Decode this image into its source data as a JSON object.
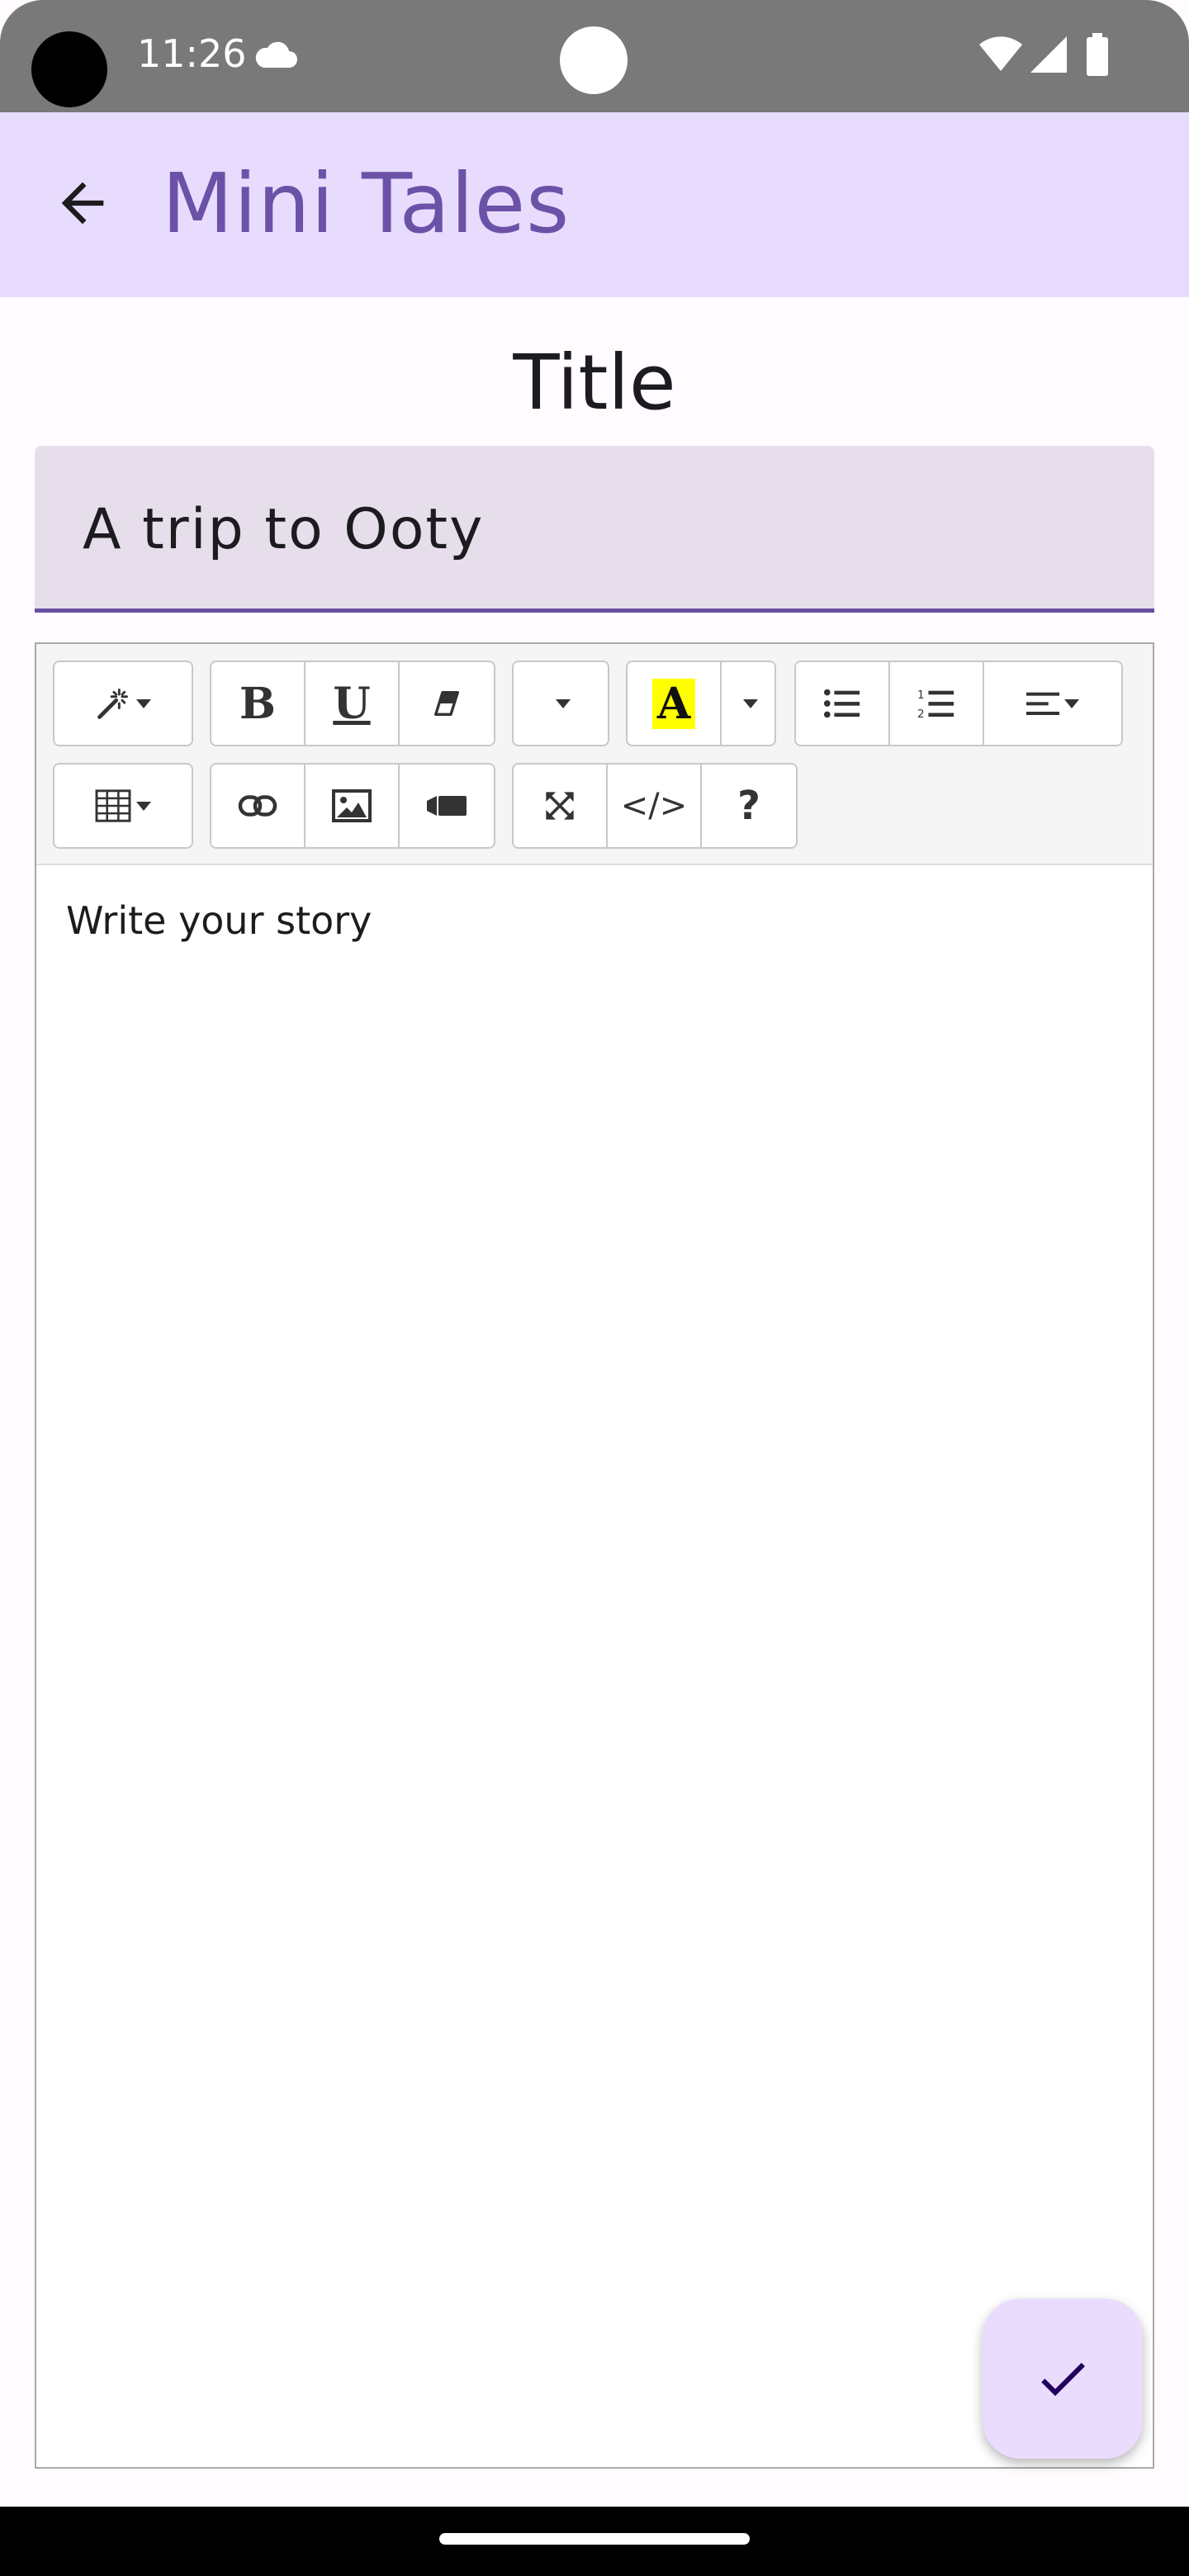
{
  "status_bar": {
    "time": "11:26",
    "icons": [
      "cloud-icon",
      "wifi-icon",
      "signal-icon",
      "battery-icon"
    ]
  },
  "app_bar": {
    "title": "Mini Tales",
    "back_icon": "arrow-left-icon"
  },
  "form": {
    "title_label": "Title",
    "title_value": "A trip to Ooty"
  },
  "editor": {
    "placeholder": "Write your story",
    "toolbar": {
      "row1": [
        "magic-wand-icon",
        "bold-icon",
        "underline-icon",
        "eraser-icon",
        "font-dropdown",
        "text-color-icon",
        "list-ul-icon",
        "list-ol-icon",
        "align-icon"
      ],
      "row2": [
        "table-icon",
        "link-icon",
        "picture-icon",
        "video-icon",
        "fullscreen-icon",
        "code-icon",
        "help-icon"
      ],
      "bold_label": "B",
      "underline_label": "U",
      "color_label": "A",
      "code_label": "</>",
      "help_label": "?"
    }
  },
  "fab": {
    "icon": "check-icon"
  },
  "colors": {
    "app_bar_bg": "#e8dcfe",
    "accent": "#6b52a7",
    "text_field_bg": "#e6dfeb",
    "fab_bg": "#e9dcfd",
    "highlight": "#ffff00"
  }
}
